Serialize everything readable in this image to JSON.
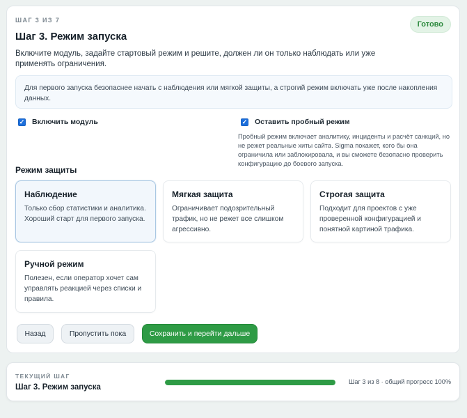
{
  "step": {
    "label": "Шаг 3 из 7",
    "badge": "Готово",
    "title": "Шаг 3. Режим запуска",
    "intro": "Включите модуль, задайте стартовый режим и решите, должен ли он только наблюдать или уже применять ограничения.",
    "info": "Для первого запуска безопаснее начать с наблюдения или мягкой защиты, а строгий режим включать уже после накопления данных."
  },
  "options": {
    "enable_module": {
      "label": "Включить модуль",
      "checked": true
    },
    "trial_mode": {
      "label": "Оставить пробный режим",
      "checked": true,
      "description": "Пробный режим включает аналитику, инциденты и расчёт санкций, но не режет реальные хиты сайта. Sigma покажет, кого бы она ограничила или заблокировала, и вы сможете безопасно проверить конфигурацию до боевого запуска."
    }
  },
  "protection": {
    "title": "Режим защиты",
    "selected": "observation",
    "modes": [
      {
        "id": "observation",
        "name": "Наблюдение",
        "description": "Только сбор статистики и аналитика. Хороший старт для первого запуска."
      },
      {
        "id": "soft",
        "name": "Мягкая защита",
        "description": "Ограничивает подозрительный трафик, но не режет все слишком агрессивно."
      },
      {
        "id": "strict",
        "name": "Строгая защита",
        "description": "Подходит для проектов с уже проверенной конфигурацией и понятной картиной трафика."
      },
      {
        "id": "manual",
        "name": "Ручной режим",
        "description": "Полезен, если оператор хочет сам управлять реакцией через списки и правила."
      }
    ]
  },
  "buttons": {
    "back": "Назад",
    "skip": "Пропустить пока",
    "save": "Сохранить и перейти дальше"
  },
  "footer": {
    "label": "Текущий шаг",
    "title": "Шаг 3. Режим запуска",
    "progress_text": "Шаг 3 из 8 · общий прогресс 100%",
    "progress": 1.0
  },
  "colors": {
    "accent_green": "#2e9b45",
    "checkbox_blue": "#1c6fdc",
    "badge_bg": "#e3f3e6"
  },
  "icons": {
    "checkbox": "check-mark"
  }
}
